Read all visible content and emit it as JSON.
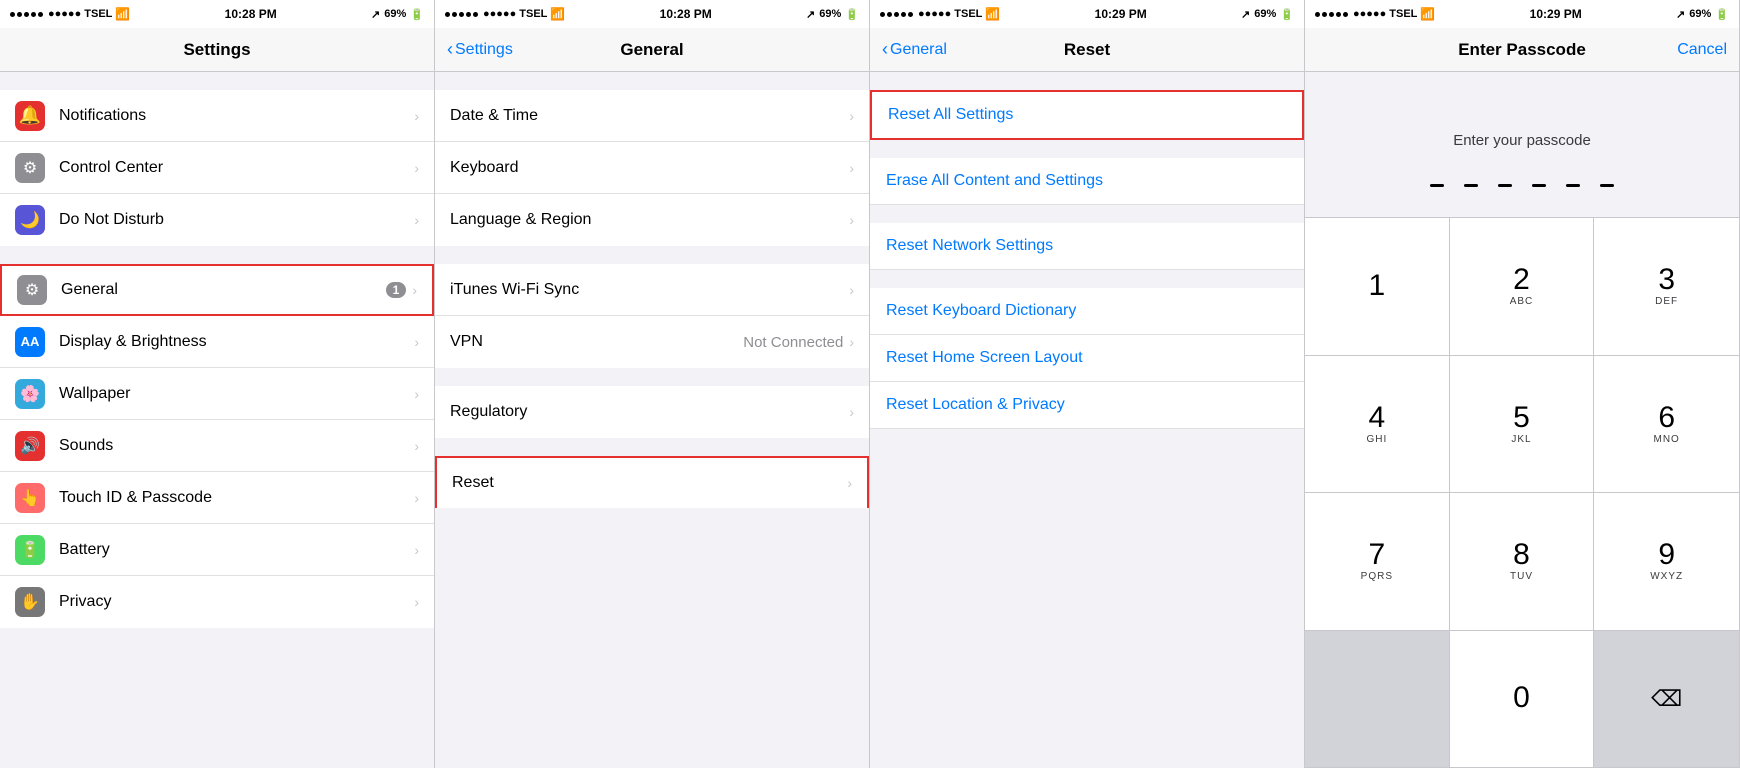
{
  "panels": [
    {
      "id": "settings",
      "statusBar": {
        "carrier": "●●●●● TSEL",
        "wifi": "wifi",
        "time": "10:28 PM",
        "location": "↗",
        "battery": "69%"
      },
      "navTitle": "Settings",
      "navBack": null,
      "rows": [
        {
          "id": "notifications",
          "icon": "notifications",
          "label": "Notifications",
          "value": "",
          "badge": "",
          "highlighted": false
        },
        {
          "id": "control-center",
          "icon": "control",
          "label": "Control Center",
          "value": "",
          "badge": "",
          "highlighted": false
        },
        {
          "id": "do-not-disturb",
          "icon": "dnd",
          "label": "Do Not Disturb",
          "value": "",
          "badge": "",
          "highlighted": false
        },
        {
          "id": "general",
          "icon": "general",
          "label": "General",
          "value": "",
          "badge": "1",
          "highlighted": true
        },
        {
          "id": "display-brightness",
          "icon": "display",
          "label": "Display & Brightness",
          "value": "",
          "badge": "",
          "highlighted": false
        },
        {
          "id": "wallpaper",
          "icon": "wallpaper",
          "label": "Wallpaper",
          "value": "",
          "badge": "",
          "highlighted": false
        },
        {
          "id": "sounds",
          "icon": "sounds",
          "label": "Sounds",
          "value": "",
          "badge": "",
          "highlighted": false
        },
        {
          "id": "touchid",
          "icon": "touchid",
          "label": "Touch ID & Passcode",
          "value": "",
          "badge": "",
          "highlighted": false
        },
        {
          "id": "battery",
          "icon": "battery",
          "label": "Battery",
          "value": "",
          "badge": "",
          "highlighted": false
        },
        {
          "id": "privacy",
          "icon": "privacy",
          "label": "Privacy",
          "value": "",
          "badge": "",
          "highlighted": false
        }
      ]
    },
    {
      "id": "general",
      "statusBar": {
        "carrier": "●●●●● TSEL",
        "wifi": "wifi",
        "time": "10:28 PM",
        "location": "↗",
        "battery": "69%"
      },
      "navTitle": "General",
      "navBack": "Settings",
      "rows": [
        {
          "id": "date-time",
          "label": "Date & Time",
          "value": "",
          "highlighted": false
        },
        {
          "id": "keyboard",
          "label": "Keyboard",
          "value": "",
          "highlighted": false
        },
        {
          "id": "language-region",
          "label": "Language & Region",
          "value": "",
          "highlighted": false
        },
        {
          "id": "itunes-wifi",
          "label": "iTunes Wi-Fi Sync",
          "value": "",
          "highlighted": false
        },
        {
          "id": "vpn",
          "label": "VPN",
          "value": "Not Connected",
          "highlighted": false
        },
        {
          "id": "regulatory",
          "label": "Regulatory",
          "value": "",
          "highlighted": false
        },
        {
          "id": "reset",
          "label": "Reset",
          "value": "",
          "highlighted": true
        }
      ]
    },
    {
      "id": "reset",
      "statusBar": {
        "carrier": "●●●●● TSEL",
        "wifi": "wifi",
        "time": "10:29 PM",
        "location": "↗",
        "battery": "69%"
      },
      "navTitle": "Reset",
      "navBack": "General",
      "items": [
        {
          "id": "reset-all-settings",
          "label": "Reset All Settings",
          "highlighted": true
        },
        {
          "id": "erase-all",
          "label": "Erase All Content and Settings",
          "highlighted": false
        },
        {
          "id": "reset-network",
          "label": "Reset Network Settings",
          "highlighted": false
        },
        {
          "id": "reset-keyboard",
          "label": "Reset Keyboard Dictionary",
          "highlighted": false
        },
        {
          "id": "reset-home",
          "label": "Reset Home Screen Layout",
          "highlighted": false
        },
        {
          "id": "reset-location",
          "label": "Reset Location & Privacy",
          "highlighted": false
        }
      ]
    },
    {
      "id": "passcode",
      "statusBar": {
        "carrier": "●●●●● TSEL",
        "wifi": "wifi",
        "time": "10:29 PM",
        "location": "↗",
        "battery": "69%"
      },
      "navTitle": "Enter Passcode",
      "navCancel": "Cancel",
      "prompt": "Enter your passcode",
      "dots": [
        1,
        2,
        3,
        4,
        5,
        6
      ],
      "keys": [
        {
          "num": "1",
          "letters": ""
        },
        {
          "num": "2",
          "letters": "ABC"
        },
        {
          "num": "3",
          "letters": "DEF"
        },
        {
          "num": "4",
          "letters": "GHI"
        },
        {
          "num": "5",
          "letters": "JKL"
        },
        {
          "num": "6",
          "letters": "MNO"
        },
        {
          "num": "7",
          "letters": "PQRS"
        },
        {
          "num": "8",
          "letters": "TUV"
        },
        {
          "num": "9",
          "letters": "WXYZ"
        },
        {
          "num": "",
          "letters": "",
          "type": "empty"
        },
        {
          "num": "0",
          "letters": ""
        },
        {
          "num": "⌫",
          "letters": "",
          "type": "backspace"
        }
      ]
    }
  ]
}
